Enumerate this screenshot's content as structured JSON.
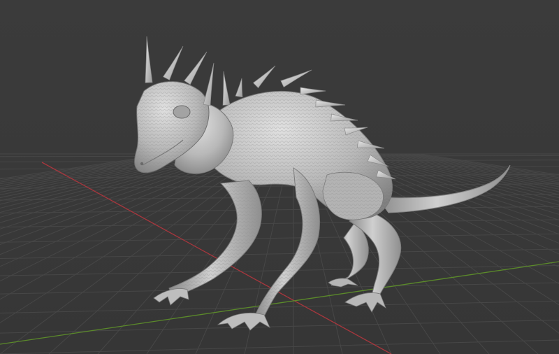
{
  "viewport": {
    "background": "#3a3a3a",
    "grid_color": "#4a4a4a",
    "x_axis_color": "#b0373f",
    "y_axis_color": "#5f8f2b"
  },
  "model": {
    "icon": "creature-sculpt-mesh",
    "base_color": "#bdbdbd",
    "shadow_color": "#7c7c7c",
    "highlight_color": "#e2e2e2"
  }
}
